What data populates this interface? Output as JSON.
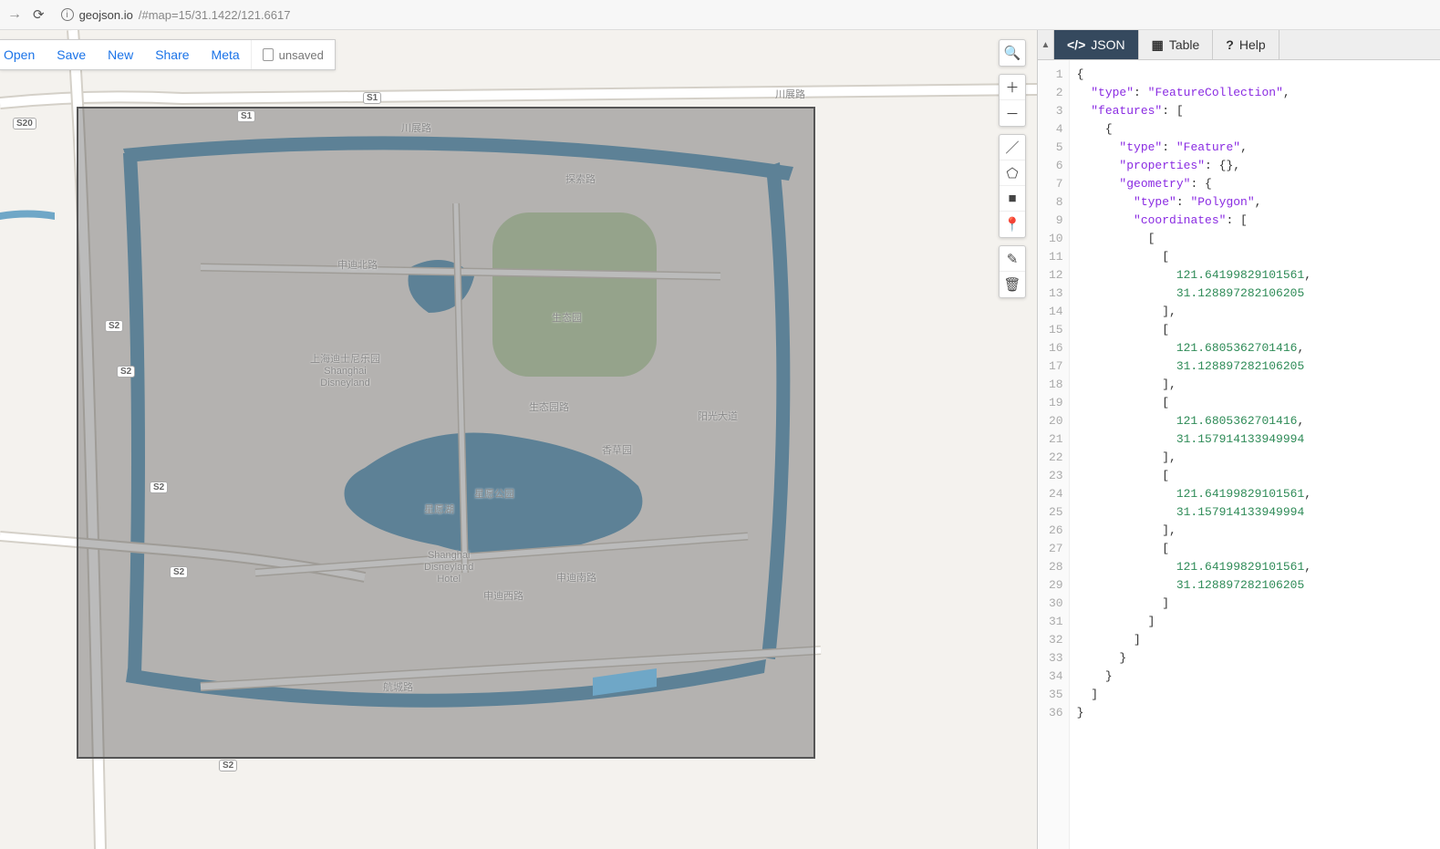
{
  "browser": {
    "url_host": "geojson.io",
    "url_hash": "/#map=15/31.1422/121.6617"
  },
  "menu": {
    "open": "Open",
    "save": "Save",
    "new": "New",
    "share": "Share",
    "meta": "Meta",
    "file_status": "unsaved"
  },
  "tabs": {
    "json": "JSON",
    "table": "Table",
    "help": "Help"
  },
  "map_labels": {
    "disneyland_cn": "上海迪士尼乐园",
    "disneyland_en": "Shanghai",
    "disneyland_en2": "Disneyland",
    "hotel_en1": "Shanghai",
    "hotel_en2": "Disneyland",
    "hotel_en3": "Hotel",
    "eco_park": "生态园",
    "xiangcao": "香草园",
    "xingyuan": "星愿公园",
    "xingyuanhu": "星愿湖",
    "chuanzhan": "川展路",
    "tansuo": "探索路",
    "shendi_n": "申迪北路",
    "shendi_s": "申迪南路",
    "shendi_w": "申迪西路",
    "shengtaiyuan": "生态园路",
    "yangguang": "阳光大道",
    "hangcheng": "航城路",
    "chuanzhan2": "川展路"
  },
  "route_badges": {
    "s1": "S1",
    "s2": "S2",
    "s20": "S20"
  },
  "geojson_code": [
    {
      "ln": 1,
      "tokens": [
        [
          "punc",
          "{"
        ]
      ]
    },
    {
      "ln": 2,
      "tokens": [
        [
          "ind",
          "  "
        ],
        [
          "key",
          "\"type\""
        ],
        [
          "punc",
          ": "
        ],
        [
          "str",
          "\"FeatureCollection\""
        ],
        [
          "punc",
          ","
        ]
      ]
    },
    {
      "ln": 3,
      "tokens": [
        [
          "ind",
          "  "
        ],
        [
          "key",
          "\"features\""
        ],
        [
          "punc",
          ": ["
        ]
      ]
    },
    {
      "ln": 4,
      "tokens": [
        [
          "ind",
          "    "
        ],
        [
          "punc",
          "{"
        ]
      ]
    },
    {
      "ln": 5,
      "tokens": [
        [
          "ind",
          "      "
        ],
        [
          "key",
          "\"type\""
        ],
        [
          "punc",
          ": "
        ],
        [
          "str",
          "\"Feature\""
        ],
        [
          "punc",
          ","
        ]
      ]
    },
    {
      "ln": 6,
      "tokens": [
        [
          "ind",
          "      "
        ],
        [
          "key",
          "\"properties\""
        ],
        [
          "punc",
          ": {},"
        ]
      ]
    },
    {
      "ln": 7,
      "tokens": [
        [
          "ind",
          "      "
        ],
        [
          "key",
          "\"geometry\""
        ],
        [
          "punc",
          ": {"
        ]
      ]
    },
    {
      "ln": 8,
      "tokens": [
        [
          "ind",
          "        "
        ],
        [
          "key",
          "\"type\""
        ],
        [
          "punc",
          ": "
        ],
        [
          "str",
          "\"Polygon\""
        ],
        [
          "punc",
          ","
        ]
      ]
    },
    {
      "ln": 9,
      "tokens": [
        [
          "ind",
          "        "
        ],
        [
          "key",
          "\"coordinates\""
        ],
        [
          "punc",
          ": ["
        ]
      ]
    },
    {
      "ln": 10,
      "tokens": [
        [
          "ind",
          "          "
        ],
        [
          "punc",
          "["
        ]
      ]
    },
    {
      "ln": 11,
      "tokens": [
        [
          "ind",
          "            "
        ],
        [
          "punc",
          "["
        ]
      ]
    },
    {
      "ln": 12,
      "tokens": [
        [
          "ind",
          "              "
        ],
        [
          "num",
          "121.64199829101561"
        ],
        [
          "punc",
          ","
        ]
      ]
    },
    {
      "ln": 13,
      "tokens": [
        [
          "ind",
          "              "
        ],
        [
          "num",
          "31.128897282106205"
        ]
      ]
    },
    {
      "ln": 14,
      "tokens": [
        [
          "ind",
          "            "
        ],
        [
          "punc",
          "],"
        ]
      ]
    },
    {
      "ln": 15,
      "tokens": [
        [
          "ind",
          "            "
        ],
        [
          "punc",
          "["
        ]
      ]
    },
    {
      "ln": 16,
      "tokens": [
        [
          "ind",
          "              "
        ],
        [
          "num",
          "121.6805362701416"
        ],
        [
          "punc",
          ","
        ]
      ]
    },
    {
      "ln": 17,
      "tokens": [
        [
          "ind",
          "              "
        ],
        [
          "num",
          "31.128897282106205"
        ]
      ]
    },
    {
      "ln": 18,
      "tokens": [
        [
          "ind",
          "            "
        ],
        [
          "punc",
          "],"
        ]
      ]
    },
    {
      "ln": 19,
      "tokens": [
        [
          "ind",
          "            "
        ],
        [
          "punc",
          "["
        ]
      ]
    },
    {
      "ln": 20,
      "tokens": [
        [
          "ind",
          "              "
        ],
        [
          "num",
          "121.6805362701416"
        ],
        [
          "punc",
          ","
        ]
      ]
    },
    {
      "ln": 21,
      "tokens": [
        [
          "ind",
          "              "
        ],
        [
          "num",
          "31.157914133949994"
        ]
      ]
    },
    {
      "ln": 22,
      "tokens": [
        [
          "ind",
          "            "
        ],
        [
          "punc",
          "],"
        ]
      ]
    },
    {
      "ln": 23,
      "tokens": [
        [
          "ind",
          "            "
        ],
        [
          "punc",
          "["
        ]
      ]
    },
    {
      "ln": 24,
      "tokens": [
        [
          "ind",
          "              "
        ],
        [
          "num",
          "121.64199829101561"
        ],
        [
          "punc",
          ","
        ]
      ]
    },
    {
      "ln": 25,
      "tokens": [
        [
          "ind",
          "              "
        ],
        [
          "num",
          "31.157914133949994"
        ]
      ]
    },
    {
      "ln": 26,
      "tokens": [
        [
          "ind",
          "            "
        ],
        [
          "punc",
          "],"
        ]
      ]
    },
    {
      "ln": 27,
      "tokens": [
        [
          "ind",
          "            "
        ],
        [
          "punc",
          "["
        ]
      ]
    },
    {
      "ln": 28,
      "tokens": [
        [
          "ind",
          "              "
        ],
        [
          "num",
          "121.64199829101561"
        ],
        [
          "punc",
          ","
        ]
      ]
    },
    {
      "ln": 29,
      "tokens": [
        [
          "ind",
          "              "
        ],
        [
          "num",
          "31.128897282106205"
        ]
      ]
    },
    {
      "ln": 30,
      "tokens": [
        [
          "ind",
          "            "
        ],
        [
          "punc",
          "]"
        ]
      ]
    },
    {
      "ln": 31,
      "tokens": [
        [
          "ind",
          "          "
        ],
        [
          "punc",
          "]"
        ]
      ]
    },
    {
      "ln": 32,
      "tokens": [
        [
          "ind",
          "        "
        ],
        [
          "punc",
          "]"
        ]
      ]
    },
    {
      "ln": 33,
      "tokens": [
        [
          "ind",
          "      "
        ],
        [
          "punc",
          "}"
        ]
      ]
    },
    {
      "ln": 34,
      "tokens": [
        [
          "ind",
          "    "
        ],
        [
          "punc",
          "}"
        ]
      ]
    },
    {
      "ln": 35,
      "tokens": [
        [
          "ind",
          "  "
        ],
        [
          "punc",
          "]"
        ]
      ]
    },
    {
      "ln": 36,
      "tokens": [
        [
          "punc",
          "}"
        ]
      ]
    }
  ]
}
